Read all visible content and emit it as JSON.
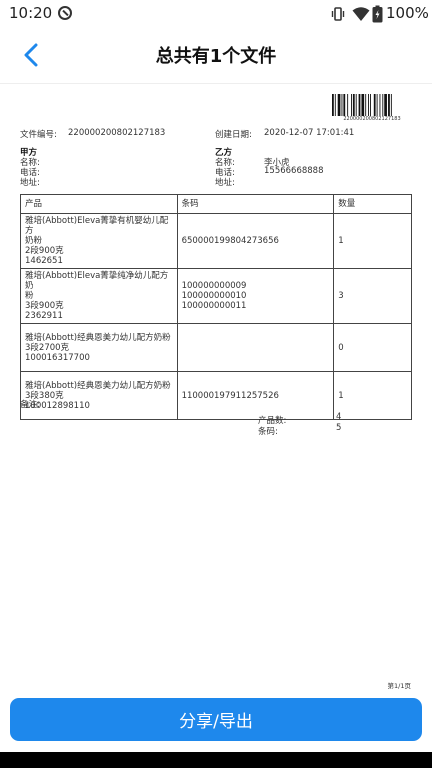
{
  "status_bar": {
    "time": "10:20",
    "battery_text": "100%"
  },
  "app_bar": {
    "title": "总共有1个文件"
  },
  "document": {
    "barcode_number": "220000200802127183",
    "file_no_label": "文件编号:",
    "file_no_value": "220000200802127183",
    "created_label": "创建日期:",
    "created_value": "2020-12-07 17:01:41",
    "party_a": {
      "heading": "甲方",
      "name_label": "名称:",
      "phone_label": "电话:",
      "address_label": "地址:"
    },
    "party_b": {
      "heading": "乙方",
      "name_label": "名称:",
      "name_value": "李小虎",
      "phone_label": "电话:",
      "phone_value": "15566668888",
      "address_label": "地址:"
    },
    "table": {
      "headers": [
        "产品",
        "条码",
        "数量"
      ],
      "rows": [
        {
          "product_lines": [
            "雅培(Abbott)Eleva菁挚有机婴幼儿配方",
            "奶粉",
            "2段900克",
            "1462651"
          ],
          "barcode_lines": [
            "650000199804273656"
          ],
          "qty": "1"
        },
        {
          "product_lines": [
            "雅培(Abbott)Eleva菁挚纯净幼儿配方奶",
            "粉",
            "3段900克",
            "2362911"
          ],
          "barcode_lines": [
            "100000000009",
            "100000000010",
            "100000000011"
          ],
          "qty": "3"
        },
        {
          "product_lines": [
            "雅培(Abbott)经典恩美力幼儿配方奶粉",
            "3段2700克",
            "100016317700"
          ],
          "barcode_lines": [],
          "qty": "0"
        },
        {
          "product_lines": [
            "雅培(Abbott)经典恩美力幼儿配方奶粉",
            "3段380克",
            "100012898110"
          ],
          "barcode_lines": [
            "110000197911257526"
          ],
          "qty": "1"
        }
      ]
    },
    "remark_label": "备注:",
    "product_count_label": "产品数:",
    "product_count_value": "4",
    "barcode_count_label": "条码:",
    "barcode_count_value": "5",
    "page_number": "第1/1页"
  },
  "share_button": {
    "label": "分享/导出"
  },
  "colors": {
    "primary": "#1e88ec",
    "back_icon": "#1e88ec"
  }
}
